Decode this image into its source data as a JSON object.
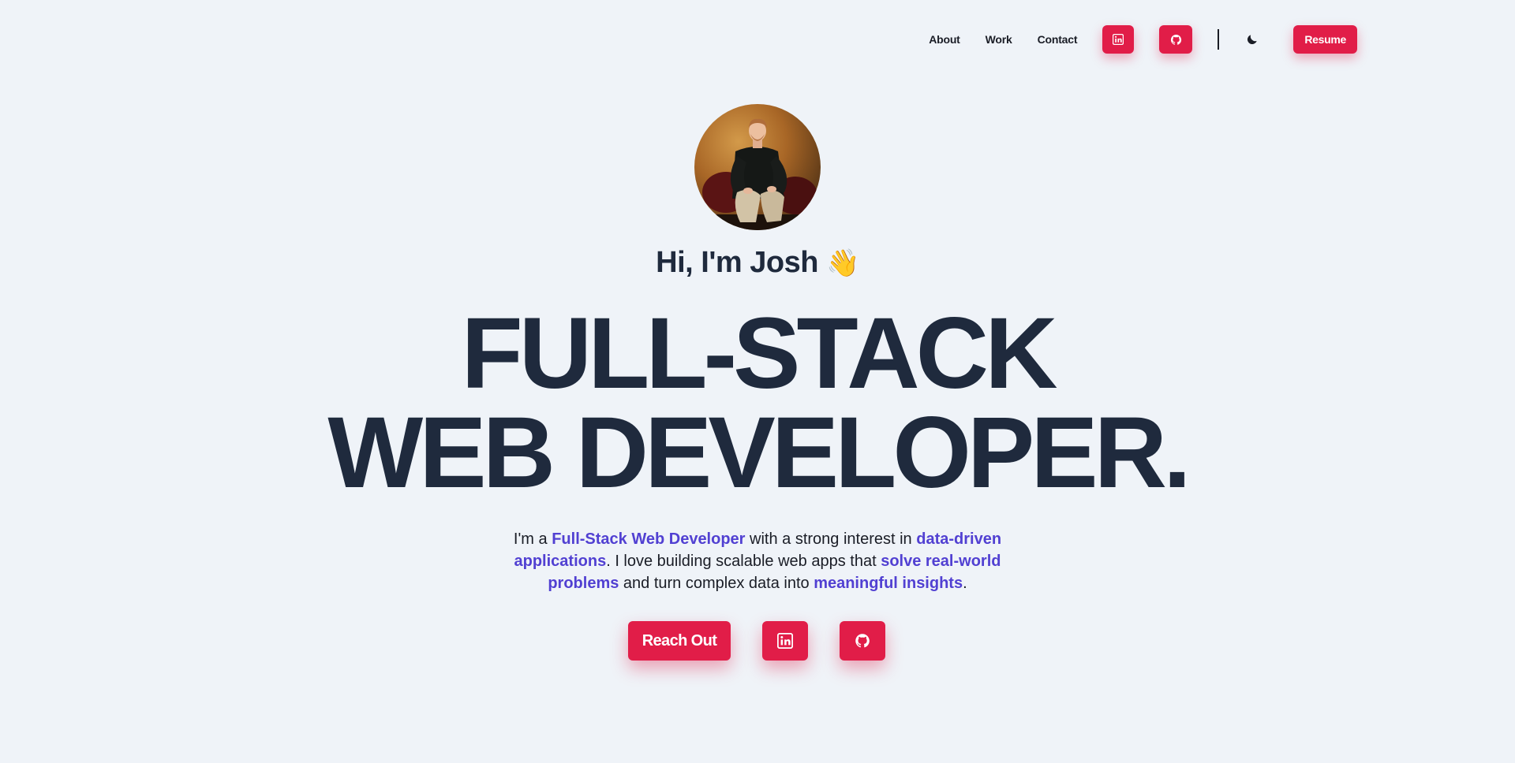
{
  "nav": {
    "links": [
      "About",
      "Work",
      "Contact"
    ],
    "linkedin_icon": "linkedin-icon",
    "github_icon": "github-icon",
    "theme_icon": "moon-icon",
    "resume_label": "Resume"
  },
  "hero": {
    "avatar_alt": "Portrait of Josh",
    "greeting": "Hi, I'm Josh",
    "greeting_emoji": "👋",
    "headline_line1": "FULL-STACK",
    "headline_line2": "WEB DEVELOPER.",
    "intro": {
      "t1": "I'm a ",
      "h1": "Full-Stack Web Developer",
      "t2": " with a strong interest in ",
      "h2": "data-driven applications",
      "t3": ". I love building scalable web apps that ",
      "h3": "solve real-world problems",
      "t4": " and turn complex data into ",
      "h4": "meaningful insights",
      "t5": "."
    },
    "cta_label": "Reach Out",
    "cta_linkedin_icon": "linkedin-icon",
    "cta_github_icon": "github-icon"
  },
  "colors": {
    "background": "#eff3f8",
    "text_dark": "#1f2a3d",
    "accent_red": "#e11d48",
    "highlight_purple": "#5140d2"
  }
}
